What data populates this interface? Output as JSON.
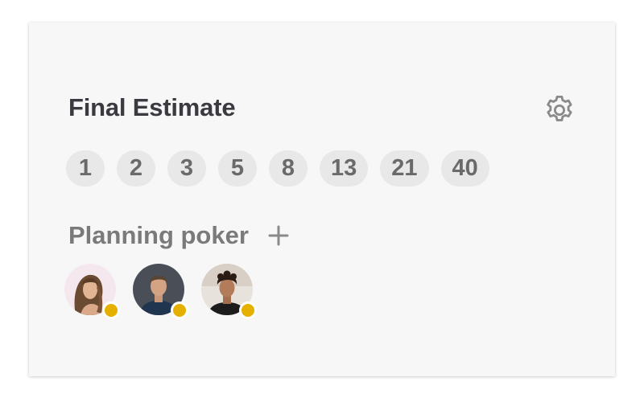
{
  "card": {
    "title": "Final Estimate",
    "settings_icon": "gear-icon",
    "estimates": [
      "1",
      "2",
      "3",
      "5",
      "8",
      "13",
      "21",
      "40"
    ],
    "section_label": "Planning poker",
    "add_icon": "plus-icon",
    "participants": [
      {
        "avatar_icon": "avatar-woman-long-hair",
        "status": "voting",
        "status_color": "#e5b000"
      },
      {
        "avatar_icon": "avatar-man-short-hair",
        "status": "voting",
        "status_color": "#e5b000"
      },
      {
        "avatar_icon": "avatar-man-curly-hair",
        "status": "voting",
        "status_color": "#e5b000"
      }
    ]
  },
  "colors": {
    "card_bg": "#f7f7f7",
    "chip_bg": "#e8e8e8",
    "chip_text": "#6a6a6a",
    "title_text": "#3a3a40",
    "label_text": "#7a7a7a",
    "status_dot": "#e5b000"
  }
}
